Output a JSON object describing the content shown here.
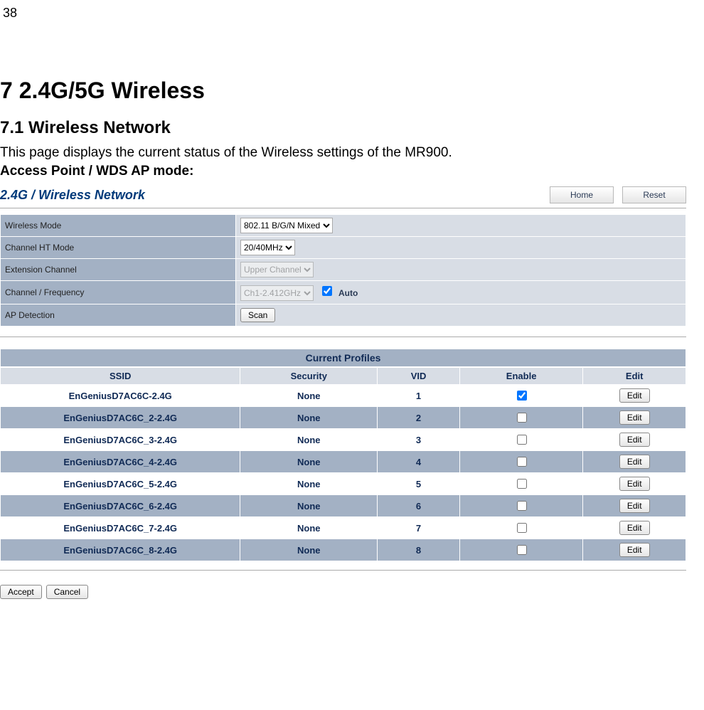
{
  "page_number": "38",
  "chapter_title": "7  2.4G/5G Wireless",
  "section_title": "7.1   Wireless Network",
  "description": "This page displays the current status of the Wireless settings of the MR900.",
  "mode_label": "Access Point / WDS AP mode:",
  "panel": {
    "title": "2.4G / Wireless Network",
    "home_btn": "Home",
    "reset_btn": "Reset"
  },
  "settings": {
    "rows": [
      {
        "label": "Wireless Mode",
        "value": "802.11 B/G/N Mixed",
        "type": "select"
      },
      {
        "label": "Channel HT Mode",
        "value": "20/40MHz",
        "type": "select"
      },
      {
        "label": "Extension Channel",
        "value": "Upper Channel",
        "type": "select-disabled"
      },
      {
        "label": "Channel / Frequency",
        "value": "Ch1-2.412GHz",
        "type": "select-disabled-auto",
        "auto_label": "Auto",
        "auto_checked": true
      },
      {
        "label": "AP Detection",
        "value": "Scan",
        "type": "button"
      }
    ]
  },
  "profiles": {
    "header": "Current Profiles",
    "columns": {
      "ssid": "SSID",
      "security": "Security",
      "vid": "VID",
      "enable": "Enable",
      "edit": "Edit"
    },
    "edit_btn": "Edit",
    "rows": [
      {
        "ssid": "EnGeniusD7AC6C-2.4G",
        "security": "None",
        "vid": "1",
        "enabled": true
      },
      {
        "ssid": "EnGeniusD7AC6C_2-2.4G",
        "security": "None",
        "vid": "2",
        "enabled": false
      },
      {
        "ssid": "EnGeniusD7AC6C_3-2.4G",
        "security": "None",
        "vid": "3",
        "enabled": false
      },
      {
        "ssid": "EnGeniusD7AC6C_4-2.4G",
        "security": "None",
        "vid": "4",
        "enabled": false
      },
      {
        "ssid": "EnGeniusD7AC6C_5-2.4G",
        "security": "None",
        "vid": "5",
        "enabled": false
      },
      {
        "ssid": "EnGeniusD7AC6C_6-2.4G",
        "security": "None",
        "vid": "6",
        "enabled": false
      },
      {
        "ssid": "EnGeniusD7AC6C_7-2.4G",
        "security": "None",
        "vid": "7",
        "enabled": false
      },
      {
        "ssid": "EnGeniusD7AC6C_8-2.4G",
        "security": "None",
        "vid": "8",
        "enabled": false
      }
    ]
  },
  "footer": {
    "accept": "Accept",
    "cancel": "Cancel"
  }
}
